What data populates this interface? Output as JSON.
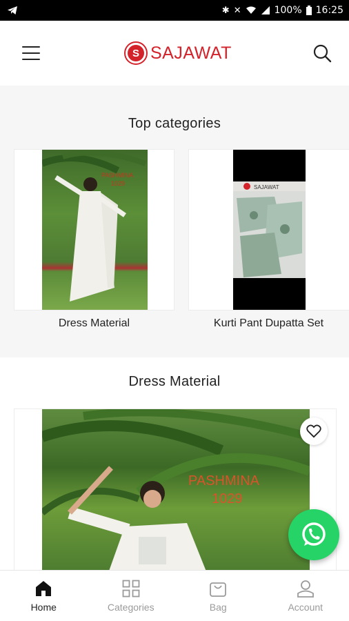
{
  "status_bar": {
    "battery": "100%",
    "time": "16:25",
    "left_icon": "telegram-icon",
    "right_icons": [
      "bluetooth-icon",
      "mute-icon",
      "wifi-icon",
      "signal-icon",
      "battery-icon"
    ]
  },
  "header": {
    "brand": "SAJAWAT",
    "logo_letter": "S",
    "menu_icon": "hamburger-menu-icon",
    "search_icon": "search-icon",
    "brand_color": "#d3222a"
  },
  "top_categories": {
    "title": "Top categories",
    "items": [
      {
        "label": "Dress Material",
        "photo_text": "PASHMINA\n1029"
      },
      {
        "label": "Kurti Pant Dupatta Set",
        "photo_text": "SAJAWAT"
      }
    ]
  },
  "dress_material": {
    "title": "Dress Material",
    "product": {
      "photo_text_line1": "PASHMINA",
      "photo_text_line2": "1029",
      "favorite_icon": "heart-icon"
    }
  },
  "whatsapp": {
    "icon": "whatsapp-icon",
    "color": "#25d366"
  },
  "bottom_nav": {
    "items": [
      {
        "label": "Home",
        "icon": "home-icon",
        "active": true
      },
      {
        "label": "Categories",
        "icon": "grid-icon",
        "active": false
      },
      {
        "label": "Bag",
        "icon": "bag-icon",
        "active": false
      },
      {
        "label": "Account",
        "icon": "user-icon",
        "active": false
      }
    ]
  }
}
